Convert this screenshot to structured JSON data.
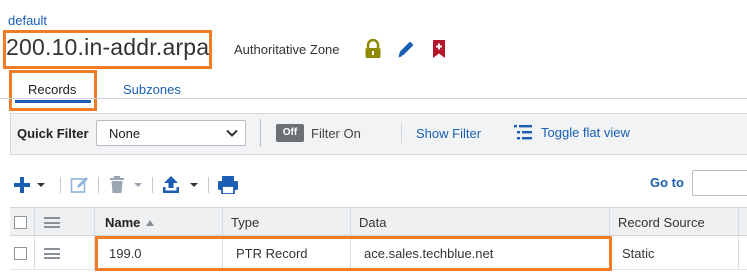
{
  "breadcrumb": "default",
  "zone": {
    "name": "200.10.in-addr.arpa",
    "type": "Authoritative Zone"
  },
  "zone_icons": [
    "lock-icon",
    "pencil-icon",
    "bookmark-icon"
  ],
  "tabs": [
    {
      "label": "Records",
      "active": true
    },
    {
      "label": "Subzones",
      "active": false
    }
  ],
  "filter": {
    "quick_filter_label": "Quick Filter",
    "quick_filter_value": "None",
    "toggle_label": "Off",
    "filter_on_label": "Filter On",
    "show_filter_label": "Show Filter",
    "toggle_flat_label": "Toggle flat view"
  },
  "toolbar": {
    "icons": [
      "add-icon",
      "edit-icon",
      "delete-icon",
      "export-icon",
      "print-icon"
    ],
    "goto_label": "Go to",
    "goto_value": ""
  },
  "grid": {
    "columns": [
      "Name",
      "Type",
      "Data",
      "Record Source"
    ],
    "sorted_column": "Name",
    "rows": [
      {
        "name": "199.0",
        "type": "PTR Record",
        "data": "ace.sales.techblue.net",
        "source": "Static"
      }
    ]
  },
  "colors": {
    "accent": "#1a5fb4",
    "highlight": "#f07c28",
    "lock": "#8e8a00",
    "bookmark": "#b4162b"
  }
}
